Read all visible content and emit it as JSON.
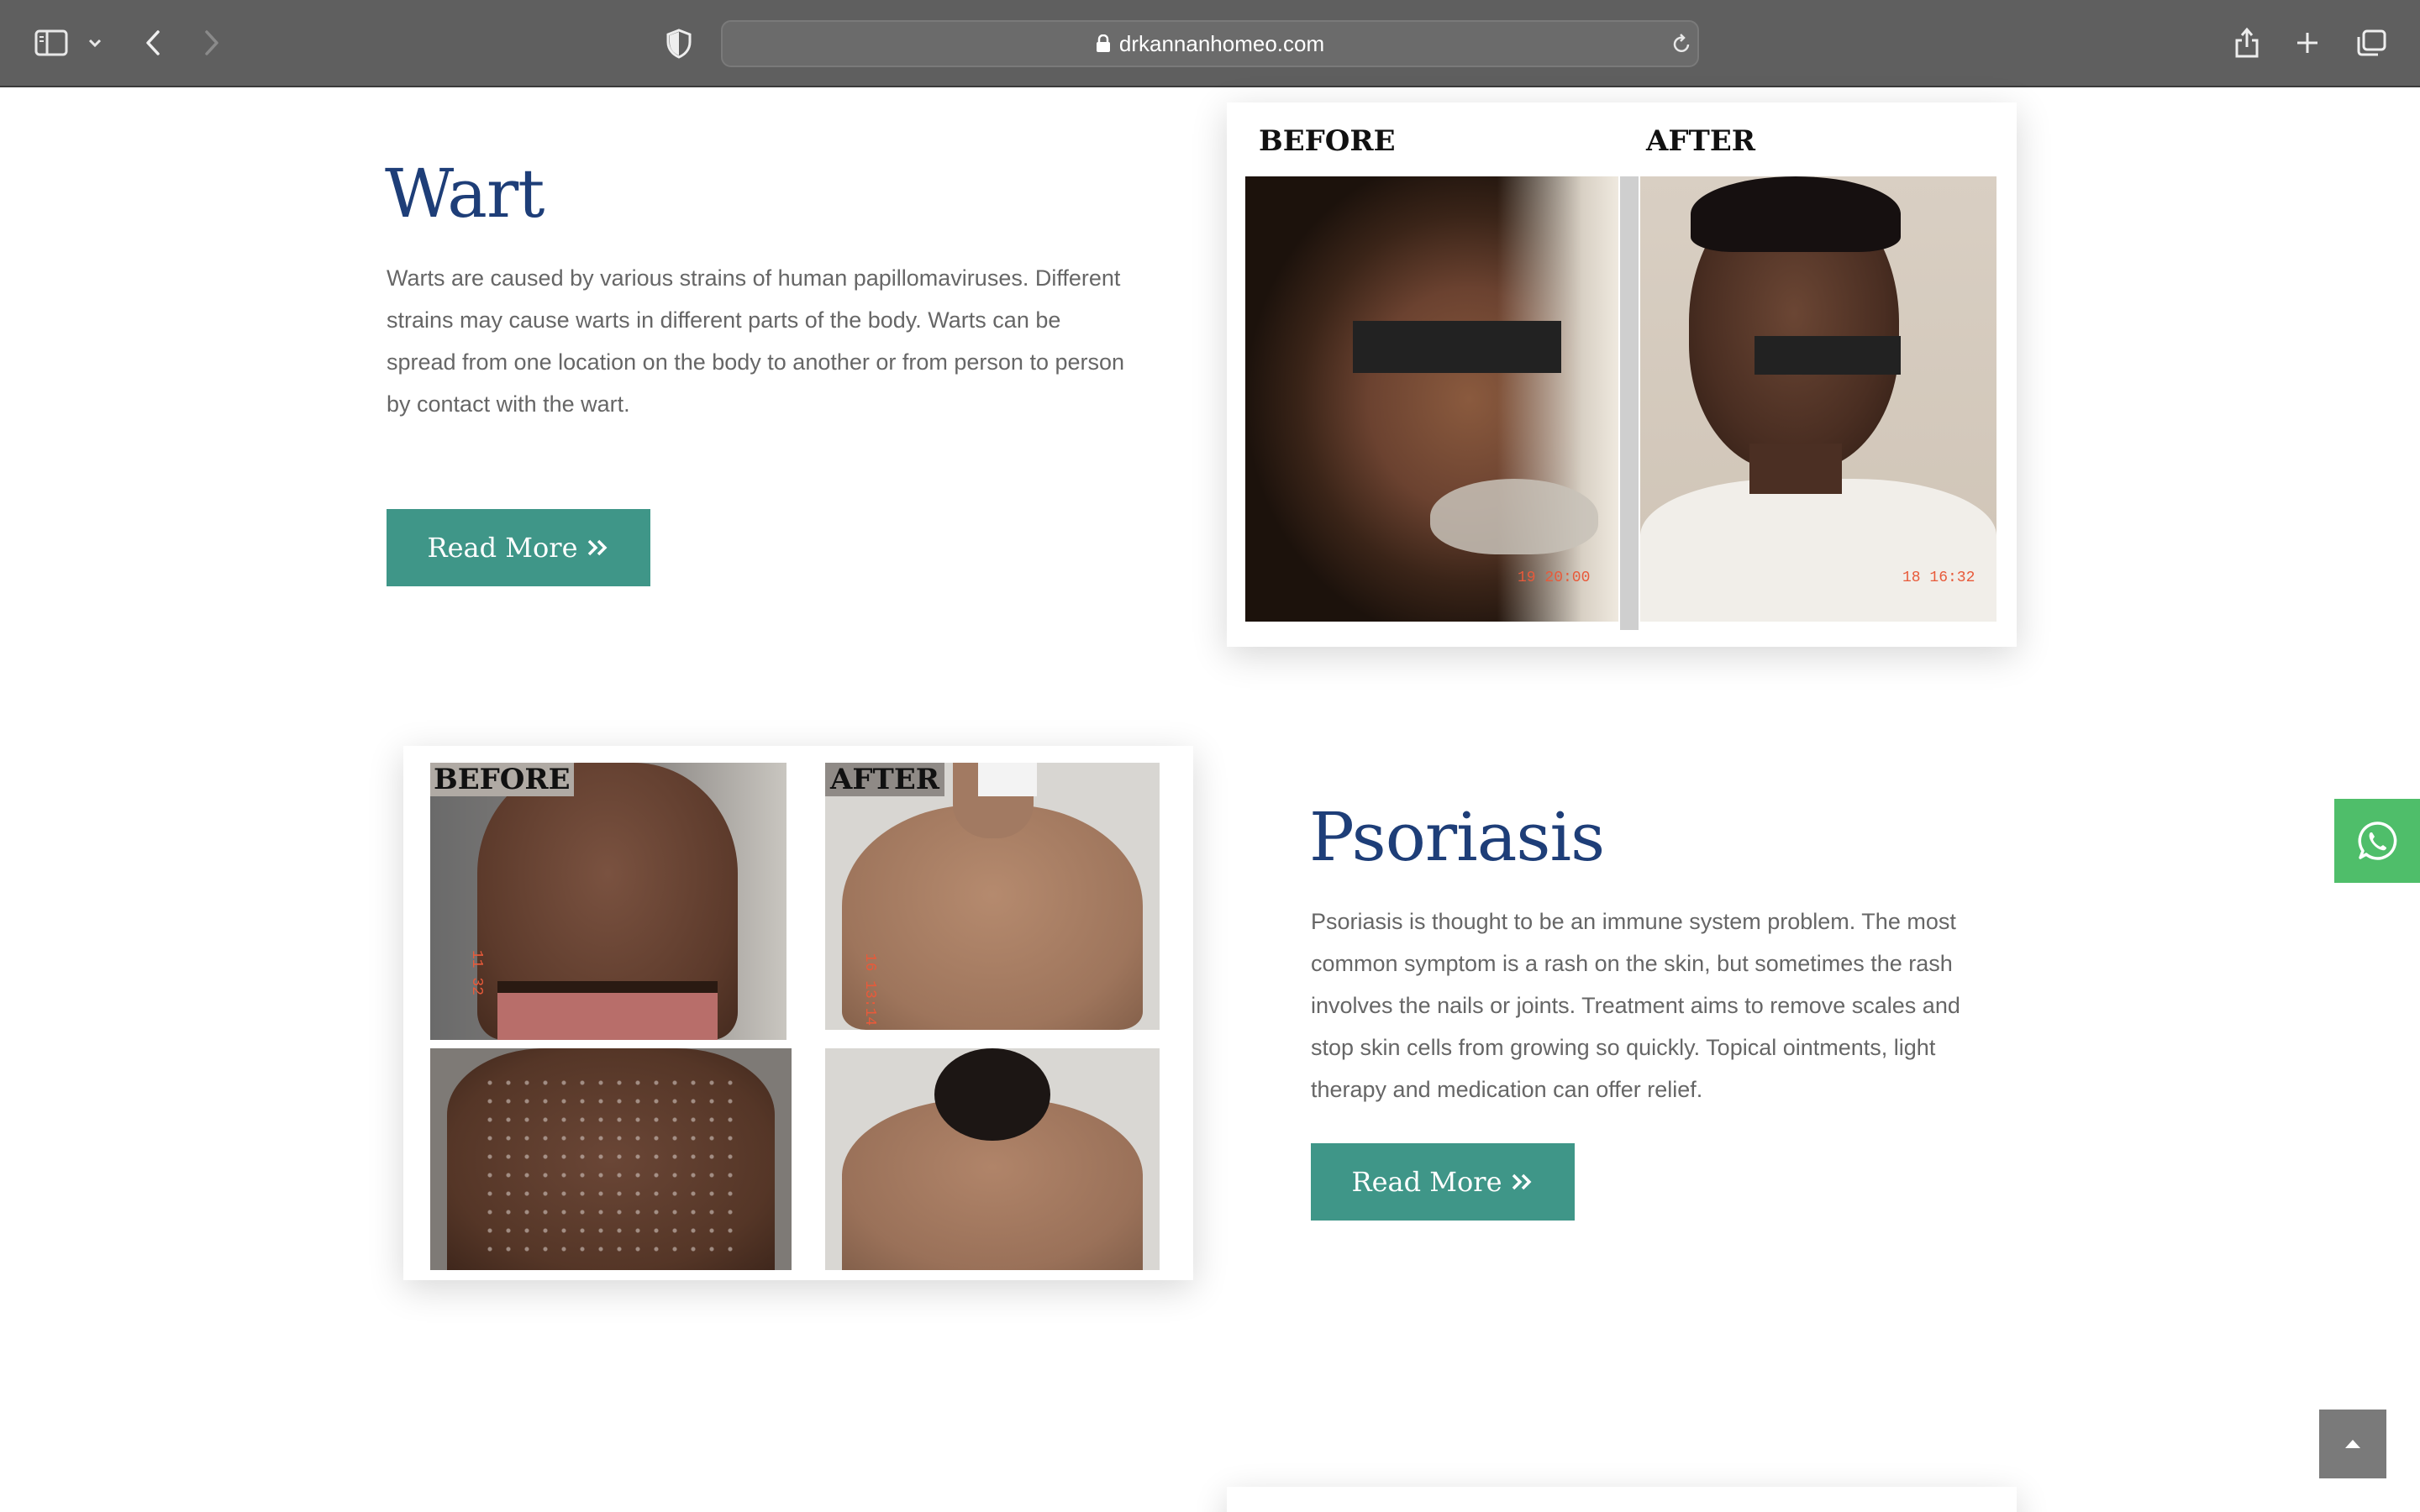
{
  "browser": {
    "url": "drkannanhomeo.com"
  },
  "sections": {
    "wart": {
      "title": "Wart",
      "description": "Warts are caused by various strains of human papillomaviruses. Different strains may cause warts in different parts of the body. Warts can be spread from one location on the body to another or from person to person by contact with the wart.",
      "button": "Read More",
      "image": {
        "before_label": "BEFORE",
        "after_label": "AFTER"
      }
    },
    "psoriasis": {
      "title": "Psoriasis",
      "description": "Psoriasis is thought to be an immune system problem. The most common symptom is a rash on the skin, but sometimes the rash involves the nails or joints. Treatment aims to remove scales and stop skin cells from growing so quickly. Topical ointments, light therapy and medication can offer relief.",
      "button": "Read More",
      "image": {
        "before_label": "BEFORE",
        "after_label": "AFTER"
      }
    }
  },
  "icons": {
    "sidebar": "sidebar-icon",
    "back": "chevron-left-icon",
    "forward": "chevron-right-icon",
    "privacy": "shield-icon",
    "reload": "reload-icon",
    "share": "share-icon",
    "new_tab": "plus-icon",
    "tabs": "tabs-icon",
    "whatsapp": "whatsapp-icon",
    "scroll_top": "chevron-up-icon"
  },
  "colors": {
    "heading": "#1e3e78",
    "body_text": "#666666",
    "button_bg": "#3f9688",
    "whatsapp": "#4fbe6a",
    "toolbar": "#5f5f5f"
  }
}
